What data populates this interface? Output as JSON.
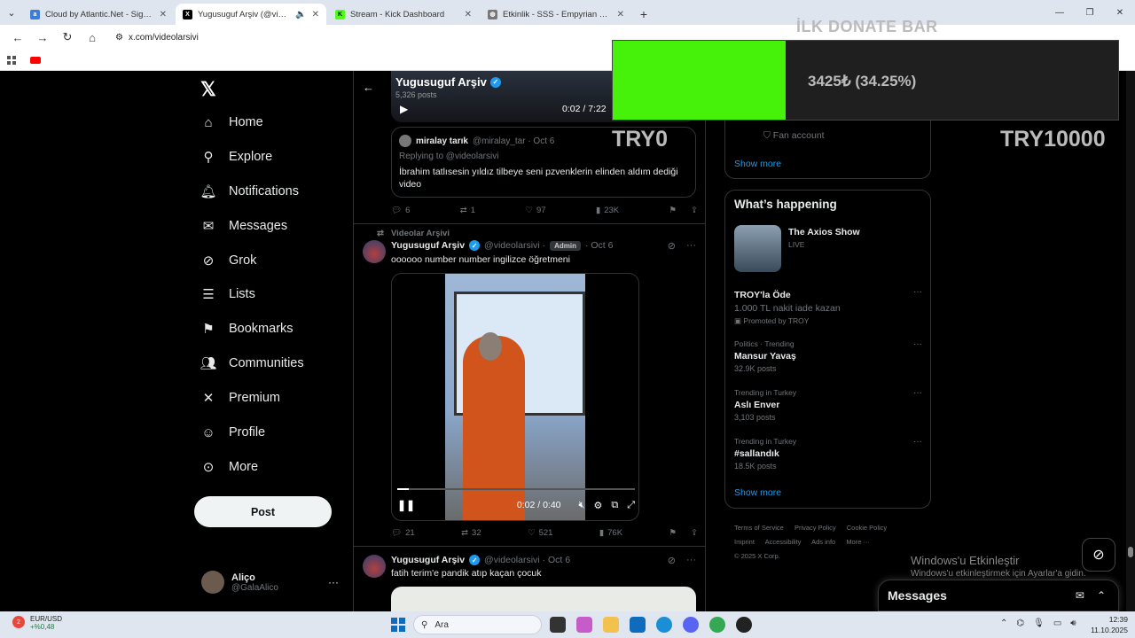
{
  "browser": {
    "tabs": [
      {
        "title": "Cloud by Atlantic.Net - Signup",
        "favicon_color": "#3b7dd8",
        "active": false
      },
      {
        "title": "Yugusuguf Arşiv (@videola",
        "favicon_color": "#000000",
        "active": true
      },
      {
        "title": "Stream - Kick Dashboard",
        "favicon_color": "#53fc18",
        "active": false
      },
      {
        "title": "Etkinlik - SSS - Empyrian Sefer",
        "favicon_color": "#555555",
        "active": false
      }
    ],
    "url": "x.com/videolarsivi"
  },
  "overlay": {
    "title": "İLK DONATE BAR",
    "amount": "3425₺ (34.25%)",
    "progress_percent": 34.25,
    "bar_color": "#46f20a",
    "min_label": "TRY0",
    "max_label": "TRY10000"
  },
  "nav": {
    "logo": "𝕏",
    "items": [
      {
        "label": "Home",
        "icon": "home-icon"
      },
      {
        "label": "Explore",
        "icon": "search-icon"
      },
      {
        "label": "Notifications",
        "icon": "bell-icon"
      },
      {
        "label": "Messages",
        "icon": "mail-icon"
      },
      {
        "label": "Grok",
        "icon": "grok-icon"
      },
      {
        "label": "Lists",
        "icon": "list-icon"
      },
      {
        "label": "Bookmarks",
        "icon": "bookmark-icon"
      },
      {
        "label": "Communities",
        "icon": "people-icon"
      },
      {
        "label": "Premium",
        "icon": "x-icon"
      },
      {
        "label": "Profile",
        "icon": "person-icon"
      },
      {
        "label": "More",
        "icon": "more-circle-icon"
      }
    ],
    "post_label": "Post",
    "account": {
      "name": "Aliço",
      "handle": "@GalaAlico"
    }
  },
  "feed": {
    "header": {
      "name": "Yugusuguf Arşiv",
      "posts": "5,326 posts",
      "video_time": "0:02 / 7:22"
    },
    "quote": {
      "name": "miralay tarık",
      "handle": "@miralay_tar · Oct 6",
      "reply": "Replying to @videolarsivi",
      "text": "İbrahim tatlısesin yıldız tilbeye seni pzvenklerin elinden aldım dediği video"
    },
    "actions1": {
      "replies": "6",
      "reposts": "1",
      "likes": "97",
      "views": "23K"
    },
    "tweet2": {
      "repost_by": "Videolar Arşivi",
      "name": "Yugusuguf Arşiv",
      "handle": "@videolarsivi ·",
      "badge": "Admin",
      "date": "· Oct 6",
      "text": "oooooo number number ingilizce öğretmeni",
      "video_time": "0:02 / 0:40",
      "video_progress_percent": 5
    },
    "actions2": {
      "replies": "21",
      "reposts": "32",
      "likes": "521",
      "views": "76K"
    },
    "tweet3": {
      "name": "Yugusuguf Arşiv",
      "handle": "@videolarsivi · Oct 6",
      "text": "fatih terim'e pandik atıp kaçan çocuk"
    }
  },
  "sidebar": {
    "fan_account": "Fan account",
    "show_more": "Show more",
    "whats_happening": "What’s happening",
    "axios": {
      "title": "The Axios Show",
      "status": "LIVE"
    },
    "promo": {
      "title": "TROY'la Öde",
      "desc": "1.000 TL nakit iade kazan",
      "by": "Promoted by TROY"
    },
    "trends": [
      {
        "context": "Politics · Trending",
        "title": "Mansur Yavaş",
        "count": "32.9K posts"
      },
      {
        "context": "Trending in Turkey",
        "title": "Aslı Enver",
        "count": "3,103 posts"
      },
      {
        "context": "Trending in Turkey",
        "title": "#sallandık",
        "count": "18.5K posts"
      }
    ],
    "footer": [
      "Terms of Service",
      "Privacy Policy",
      "Cookie Policy",
      "Imprint",
      "Accessibility",
      "Ads info",
      "More ···",
      "© 2025 X Corp."
    ]
  },
  "messages": {
    "label": "Messages"
  },
  "watermark": {
    "line1": "Windows'u Etkinleştir",
    "line2": "Windows'u etkinleştirmek için Ayarlar'a gidin."
  },
  "taskbar": {
    "currency": "EUR/USD",
    "currency_change": "+%0,48",
    "notif_count": "2",
    "search_label": "Ara",
    "time": "12:39",
    "date": "11.10.2025"
  }
}
